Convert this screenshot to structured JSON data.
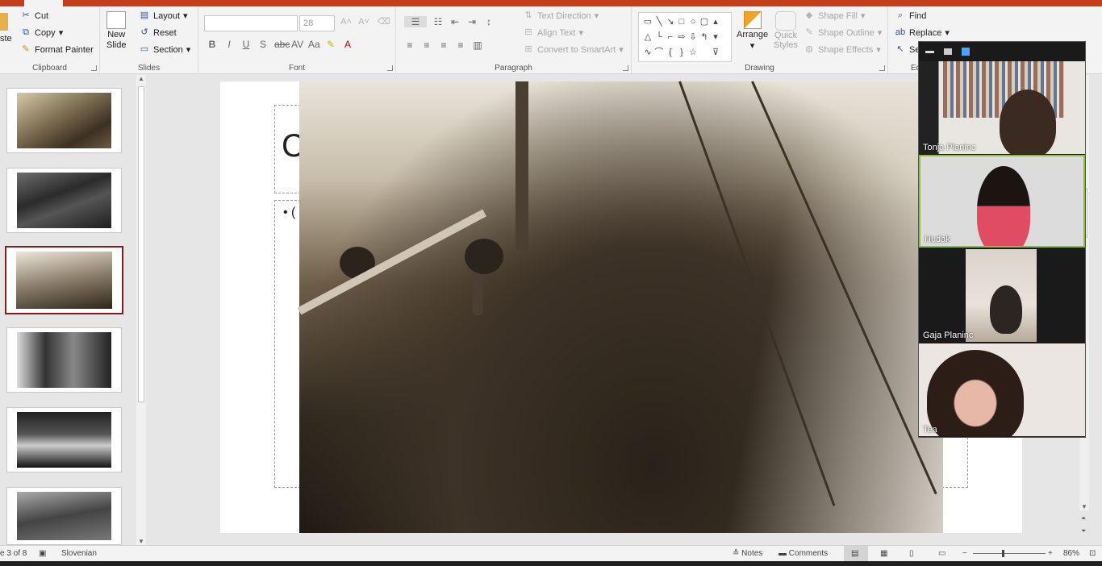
{
  "ribbon": {
    "clipboard": {
      "paste_label": "ste",
      "cut": "Cut",
      "copy": "Copy",
      "format_painter": "Format Painter",
      "group_label": "Clipboard"
    },
    "slides": {
      "new_slide_line1": "New",
      "new_slide_line2": "Slide",
      "layout": "Layout",
      "reset": "Reset",
      "section": "Section",
      "group_label": "Slides"
    },
    "font": {
      "font_name": "",
      "font_size": "28",
      "group_label": "Font"
    },
    "paragraph": {
      "text_direction": "Text Direction",
      "align_text": "Align Text",
      "convert_smartart": "Convert to SmartArt",
      "group_label": "Paragraph"
    },
    "drawing": {
      "arrange": "Arrange",
      "quick_styles_line1": "Quick",
      "quick_styles_line2": "Styles",
      "shape_fill": "Shape Fill",
      "shape_outline": "Shape Outline",
      "shape_effects": "Shape Effects",
      "group_label": "Drawing"
    },
    "editing": {
      "find": "Find",
      "replace": "Replace",
      "select": "Se",
      "group_label": "Ed"
    }
  },
  "slide": {
    "title_fragment": "C",
    "bullet_fragment": "•  ("
  },
  "video_panel": {
    "participants": [
      {
        "name": "Tonja Planinc"
      },
      {
        "name": "Hudak"
      },
      {
        "name": "Gaja Planinc"
      },
      {
        "name": "Tea"
      }
    ]
  },
  "status_bar": {
    "slide_counter": "e 3 of 8",
    "language": "Slovenian",
    "notes": "Notes",
    "comments": "Comments",
    "zoom": "86%"
  },
  "colors": {
    "accent": "#c43e1c",
    "selected_thumb": "#8b1a1a",
    "active_speaker": "#8bbf3a"
  }
}
